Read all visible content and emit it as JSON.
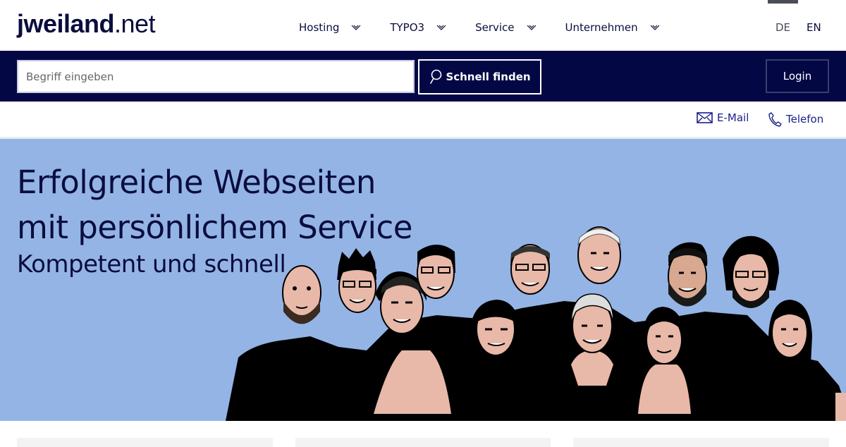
{
  "header": {
    "logo": {
      "bold": "jweiland",
      "light": ".net"
    },
    "nav": [
      {
        "label": "Hosting",
        "icon": "chevron-down-icon"
      },
      {
        "label": "TYPO3",
        "icon": "chevron-down-icon"
      },
      {
        "label": "Service",
        "icon": "chevron-down-icon"
      },
      {
        "label": "Unternehmen",
        "icon": "chevron-down-icon"
      }
    ],
    "languages": [
      {
        "code": "DE",
        "active": true
      },
      {
        "code": "EN",
        "active": false
      }
    ]
  },
  "search": {
    "placeholder": "Begriff eingeben",
    "value": "",
    "button_label": "Schnell finden",
    "button_icon": "search-icon"
  },
  "login": {
    "label": "Login"
  },
  "contact": {
    "email": {
      "label": "E-Mail",
      "icon": "envelope-icon"
    },
    "phone": {
      "label": "Telefon",
      "icon": "phone-icon"
    }
  },
  "hero": {
    "headline_line1": "Erfolgreiche Webseiten",
    "headline_line2": "mit persönlichem Service",
    "subheadline": "Kompetent und schnell",
    "image_alt": "Team illustration",
    "team_count": 11
  },
  "colors": {
    "brand_navy": "#030845",
    "text_navy": "#0a0d3d",
    "hero_bg": "#94b4e6",
    "link_blue": "#1a1f8a",
    "skin": "#e8b8a8"
  }
}
